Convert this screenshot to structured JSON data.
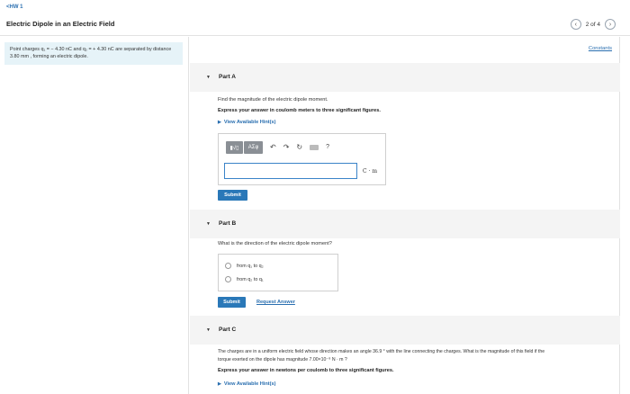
{
  "header": {
    "back_label": "<HW 1",
    "title": "Electric Dipole in an Electric Field",
    "pager": "2 of 4",
    "prev_icon": "chevron-left-icon",
    "next_icon": "chevron-right-icon"
  },
  "sidebar": {
    "problem_text": "Point charges q₁ = − 4.30 nC and q₂ = + 4.30 nC are separated by distance 3.80 mm , forming an electric dipole."
  },
  "constants_label": "Constants",
  "part_a": {
    "label": "Part A",
    "question": "Find the magnitude of the electric dipole moment.",
    "instruction": "Express your answer in coulomb meters to three significant figures.",
    "hint_label": "View Available Hint(s)",
    "toolbar_templates": "▮√▯",
    "toolbar_greek": "ΑΣφ",
    "toolbar_help": "?",
    "answer_value": "",
    "unit": "C · m",
    "submit_label": "Submit"
  },
  "part_b": {
    "label": "Part B",
    "question": "What is the direction of the electric dipole moment?",
    "options": [
      "from q₁ to q₂",
      "from q₂ to q₁"
    ],
    "submit_label": "Submit",
    "request_answer_label": "Request Answer"
  },
  "part_c": {
    "label": "Part C",
    "question_line1": "The charges are in a uniform electric field whose direction makes an angle 36.9 ° with the line connecting the charges. What is the magnitude of this field if the",
    "question_line2": "torque exerted on the dipole has magnitude 7.00×10⁻⁹ N · m ?",
    "instruction": "Express your answer in newtons per coulomb to three significant figures.",
    "hint_label": "View Available Hint(s)"
  },
  "colors": {
    "accent": "#2a78b8",
    "link": "#2a6fb0",
    "problem_bg": "#e6f3f8",
    "part_header_bg": "#f4f4f4"
  }
}
